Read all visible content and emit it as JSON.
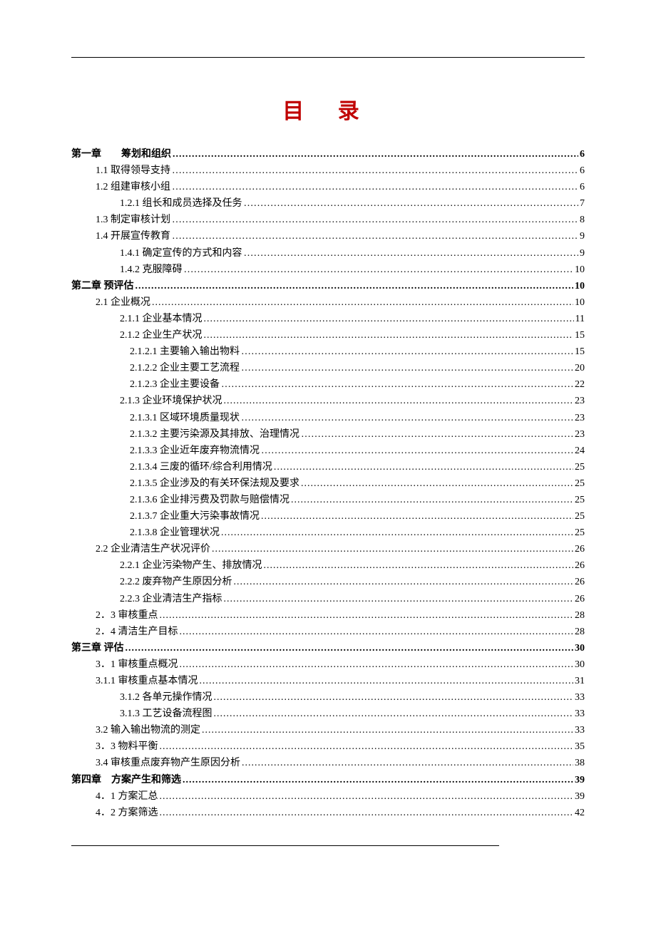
{
  "title": "目 录",
  "entries": [
    {
      "label": "第一章　　筹划和组织",
      "page": "6",
      "level": 0,
      "dots": "dense"
    },
    {
      "label": "1.1 取得领导支持",
      "page": "6",
      "level": 1,
      "dots": "dot"
    },
    {
      "label": "1.2 组建审核小组",
      "page": "6",
      "level": 1,
      "dots": "dot"
    },
    {
      "label": "1.2.1 组长和成员选择及任务",
      "page": "7",
      "level": 2,
      "dots": "dot"
    },
    {
      "label": "1.3 制定审核计划",
      "page": "8",
      "level": 1,
      "dots": "dot"
    },
    {
      "label": "1.4 开展宣传教育",
      "page": "9",
      "level": 1,
      "dots": "dot"
    },
    {
      "label": "1.4.1 确定宣传的方式和内容",
      "page": "9",
      "level": 2,
      "dots": "dot"
    },
    {
      "label": "1.4.2 克服障碍",
      "page": "10",
      "level": 2,
      "dots": "dot"
    },
    {
      "label": "第二章 预评估",
      "page": "10",
      "level": 0,
      "dots": "dense"
    },
    {
      "label": "2.1 企业概况",
      "page": "10",
      "level": 1,
      "dots": "dense"
    },
    {
      "label": "2.1.1 企业基本情况",
      "page": "11",
      "level": 2,
      "dots": "dense"
    },
    {
      "label": "2.1.2 企业生产状况",
      "page": "15",
      "level": 2,
      "dots": "dense"
    },
    {
      "label": "2.1.2.1 主要输入输出物料",
      "page": "15",
      "level": 3,
      "dots": "dot"
    },
    {
      "label": "2.1.2.2 企业主要工艺流程",
      "page": "20",
      "level": 3,
      "dots": "dot"
    },
    {
      "label": "2.1.2.3 企业主要设备",
      "page": "22",
      "level": 3,
      "dots": "dot"
    },
    {
      "label": "2.1.3 企业环境保护状况",
      "page": "23",
      "level": 2,
      "dots": "dense"
    },
    {
      "label": "2.1.3.1 区域环境质量现状",
      "page": "23",
      "level": 3,
      "dots": "dot"
    },
    {
      "label": "2.1.3.2 主要污染源及其排放、治理情况",
      "page": "23",
      "level": 3,
      "dots": "dot"
    },
    {
      "label": "2.1.3.3 企业近年废弃物流情况",
      "page": "24",
      "level": 3,
      "dots": "dot"
    },
    {
      "label": "2.1.3.4 三废的循环/综合利用情况",
      "page": "25",
      "level": 3,
      "dots": "dense"
    },
    {
      "label": "2.1.3.5 企业涉及的有关环保法规及要求",
      "page": "25",
      "level": 3,
      "dots": "dense"
    },
    {
      "label": "2.1.3.6 企业排污费及罚款与赔偿情况",
      "page": "25",
      "level": 3,
      "dots": "dense"
    },
    {
      "label": "2.1.3.7 企业重大污染事故情况",
      "page": "25",
      "level": 3,
      "dots": "dense"
    },
    {
      "label": "2.1.3.8 企业管理状况",
      "page": "25",
      "level": 3,
      "dots": "dense"
    },
    {
      "label": "2.2 企业清洁生产状况评价",
      "page": "26",
      "level": 1,
      "dots": "dense"
    },
    {
      "label": "2.2.1 企业污染物产生、排放情况",
      "page": "26",
      "level": 2,
      "dots": "dense"
    },
    {
      "label": "2.2.2 废弃物产生原因分析",
      "page": "26",
      "level": 2,
      "dots": "dense"
    },
    {
      "label": "2.2.3 企业清洁生产指标",
      "page": "26",
      "level": 2,
      "dots": "dense"
    },
    {
      "label": "2．3 审核重点",
      "page": "28",
      "level": 1,
      "dots": "dense"
    },
    {
      "label": "2．4 清洁生产目标",
      "page": "28",
      "level": 1,
      "dots": "dense"
    },
    {
      "label": "第三章 评估",
      "page": "30",
      "level": 0,
      "dots": "dense"
    },
    {
      "label": "3．1 审核重点概况",
      "page": "30",
      "level": 1,
      "dots": "dense"
    },
    {
      "label": "3.1.1 审核重点基本情况",
      "page": "31",
      "level": 1,
      "dots": "dense"
    },
    {
      "label": "3.1.2 各单元操作情况",
      "page": "33",
      "level": 2,
      "dots": "dense"
    },
    {
      "label": "3.1.3 工艺设备流程图",
      "page": "33",
      "level": 2,
      "dots": "dense"
    },
    {
      "label": "3.2 输入输出物流的测定",
      "page": "33",
      "level": 1,
      "dots": "dense"
    },
    {
      "label": "3．3 物料平衡",
      "page": "35",
      "level": 1,
      "dots": "dense"
    },
    {
      "label": "3.4 审核重点废弃物产生原因分析",
      "page": "38",
      "level": 1,
      "dots": "dense"
    },
    {
      "label": "第四章　方案产生和筛选",
      "page": "39",
      "level": 0,
      "dots": "dense"
    },
    {
      "label": "4．1 方案汇总",
      "page": "39",
      "level": 1,
      "dots": "dense"
    },
    {
      "label": "4．2 方案筛选",
      "page": "42",
      "level": 1,
      "dots": "dense"
    }
  ]
}
